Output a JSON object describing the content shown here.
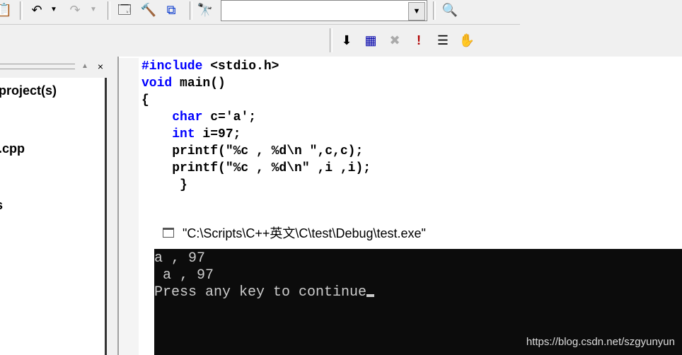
{
  "toolbar": {
    "icons": [
      "paste-icon",
      "undo-icon",
      "redo-icon",
      "workspace-icon",
      "output-icon",
      "windows-icon",
      "find-in-files-icon",
      "find-icon"
    ],
    "build_icons": [
      "compile-icon",
      "build-icon",
      "stop-build-icon",
      "execute-icon",
      "go-icon",
      "breakpoint-icon"
    ],
    "combo_value": ""
  },
  "workspace": {
    "items": [
      "project(s)",
      ".cpp",
      "s"
    ]
  },
  "editor": {
    "lines": [
      [
        {
          "t": "#include",
          "k": true
        },
        {
          "t": " <stdio.h>",
          "k": false
        }
      ],
      [
        {
          "t": "void",
          "k": true
        },
        {
          "t": " main()",
          "k": false
        }
      ],
      [
        {
          "t": "{",
          "k": false
        }
      ],
      [
        {
          "t": "    ",
          "k": false
        },
        {
          "t": "char",
          "k": true
        },
        {
          "t": " c='a';",
          "k": false
        }
      ],
      [
        {
          "t": "    ",
          "k": false
        },
        {
          "t": "int",
          "k": true
        },
        {
          "t": " i=97;",
          "k": false
        }
      ],
      [
        {
          "t": "    printf(\"%c , %d\\n \",c,c);",
          "k": false
        }
      ],
      [
        {
          "t": "    printf(\"%c , %d\\n\" ,i ,i);",
          "k": false
        }
      ],
      [
        {
          "t": "     }",
          "k": false
        }
      ]
    ]
  },
  "console": {
    "title": "\"C:\\Scripts\\C++英文\\C\\test\\Debug\\test.exe\"",
    "output": [
      "a , 97",
      " a , 97",
      "Press any key to continue"
    ]
  },
  "watermark": "https://blog.csdn.net/szgyunyun",
  "colors": {
    "keyword": "#0000ff",
    "console_bg": "#0c0c0c",
    "console_text": "#cccccc"
  }
}
